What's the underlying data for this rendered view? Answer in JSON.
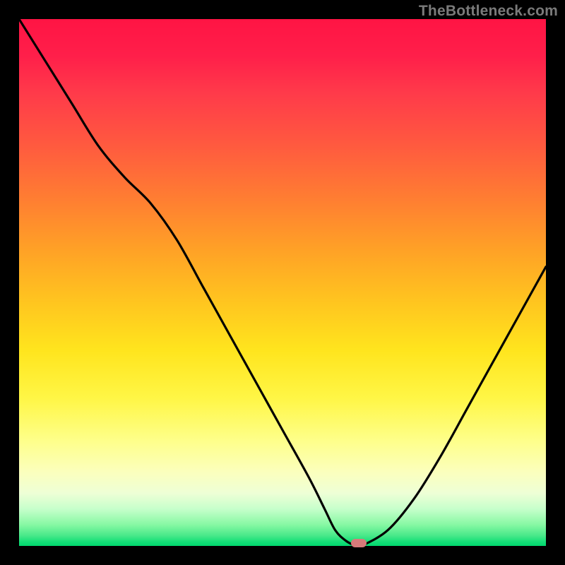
{
  "watermark": "TheBottleneck.com",
  "colors": {
    "background": "#000000",
    "line": "#000000",
    "marker": "#d77a7a",
    "gradient_top": "#ff1444",
    "gradient_bottom": "#00d96e"
  },
  "chart_data": {
    "type": "line",
    "title": "",
    "xlabel": "",
    "ylabel": "",
    "xlim": [
      0,
      100
    ],
    "ylim": [
      0,
      100
    ],
    "x": [
      0,
      5,
      10,
      15,
      20,
      25,
      30,
      35,
      40,
      45,
      50,
      55,
      58,
      60,
      62,
      64,
      65,
      70,
      75,
      80,
      85,
      90,
      95,
      100
    ],
    "values": [
      100,
      92,
      84,
      76,
      70,
      65,
      58,
      49,
      40,
      31,
      22,
      13,
      7,
      3,
      1,
      0,
      0,
      3,
      9,
      17,
      26,
      35,
      44,
      53
    ],
    "marker": {
      "x": 64.5,
      "y": 0
    },
    "annotations": []
  }
}
